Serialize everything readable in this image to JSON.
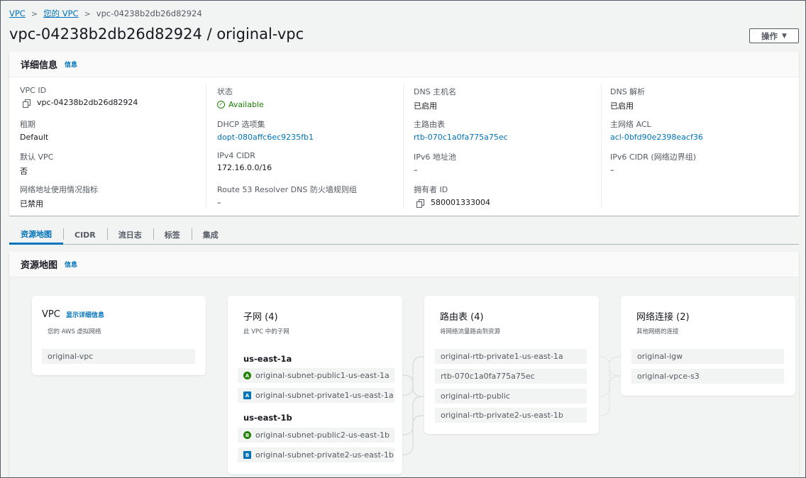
{
  "breadcrumb": {
    "items": [
      "VPC",
      "您的 VPC"
    ],
    "current": "vpc-04238b2db26d82924"
  },
  "header": {
    "title": "vpc-04238b2db26d82924 / original-vpc",
    "actions_label": "操作"
  },
  "details": {
    "title": "详细信息",
    "info": "信息",
    "fields": {
      "vpc_id": {
        "label": "VPC ID",
        "value": "vpc-04238b2db26d82924"
      },
      "state": {
        "label": "状态",
        "value": "Available"
      },
      "dns_hostnames": {
        "label": "DNS 主机名",
        "value": "已启用"
      },
      "dns_resolution": {
        "label": "DNS 解析",
        "value": "已启用"
      },
      "tenancy": {
        "label": "租期",
        "value": "Default"
      },
      "dhcp": {
        "label": "DHCP 选项集",
        "value": "dopt-080affc6ec9235fb1"
      },
      "main_route_table": {
        "label": "主路由表",
        "value": "rtb-070c1a0fa775a75ec"
      },
      "main_acl": {
        "label": "主网络 ACL",
        "value": "acl-0bfd90e2398eacf36"
      },
      "default_vpc": {
        "label": "默认 VPC",
        "value": "否"
      },
      "ipv4_cidr": {
        "label": "IPv4 CIDR",
        "value": "172.16.0.0/16"
      },
      "ipv6_pool": {
        "label": "IPv6 地址池",
        "value": "–"
      },
      "ipv6_cidr": {
        "label": "IPv6 CIDR (网络边界组)",
        "value": "–"
      },
      "net_usage": {
        "label": "网络地址使用情况指标",
        "value": "已禁用"
      },
      "route53": {
        "label": "Route 53 Resolver DNS 防火墙规则组",
        "value": "–"
      },
      "owner": {
        "label": "拥有者 ID",
        "value": "580001333004"
      }
    }
  },
  "tabs": [
    "资源地图",
    "CIDR",
    "流日志",
    "标签",
    "集成"
  ],
  "resource_map": {
    "title": "资源地图",
    "info": "信息",
    "vpc": {
      "title": "VPC",
      "show_details": "显示详细信息",
      "subtitle": "您的 AWS 虚拟网络",
      "items": [
        "original-vpc"
      ]
    },
    "subnets": {
      "title": "子网 (4)",
      "subtitle": "此 VPC 中的子网",
      "az1": "us-east-1a",
      "az2": "us-east-1b",
      "items": [
        {
          "badge": "A",
          "type": "public",
          "name": "original-subnet-public1-us-east-1a"
        },
        {
          "badge": "A",
          "type": "private",
          "name": "original-subnet-private1-us-east-1a"
        },
        {
          "badge": "B",
          "type": "public",
          "name": "original-subnet-public2-us-east-1b"
        },
        {
          "badge": "B",
          "type": "private",
          "name": "original-subnet-private2-us-east-1b"
        }
      ]
    },
    "route_tables": {
      "title": "路由表 (4)",
      "subtitle": "将网络流量路由到资源",
      "items": [
        "original-rtb-private1-us-east-1a",
        "rtb-070c1a0fa775a75ec",
        "original-rtb-public",
        "original-rtb-private2-us-east-1b"
      ]
    },
    "connections": {
      "title": "网络连接 (2)",
      "subtitle": "其他网络的连接",
      "items": [
        "original-igw",
        "original-vpce-s3"
      ]
    }
  },
  "colors": {
    "link": "#0073bb",
    "available": "#1d8102",
    "public_badge": "#1d8102",
    "private_badge": "#0073bb"
  }
}
